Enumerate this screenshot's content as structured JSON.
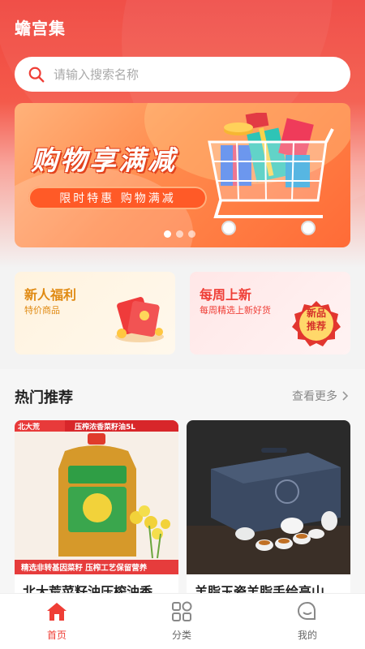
{
  "app": {
    "title": "蟾宫集"
  },
  "search": {
    "placeholder": "请输入搜索名称"
  },
  "banner": {
    "title": "购物享满减",
    "subtitle": "限时特惠  购物满减",
    "slide_count": 3,
    "active_slide": 1
  },
  "promos": [
    {
      "title": "新人福利",
      "subtitle": "特价商品",
      "color": "#e08a12"
    },
    {
      "title": "每周上新",
      "subtitle": "每周精选上新好货",
      "badge": [
        "新品",
        "推荐"
      ],
      "color": "#ef3e36"
    }
  ],
  "hot": {
    "title": "热门推荐",
    "more_label": "查看更多",
    "products": [
      {
        "name": "北大荒菜籽油压榨油香",
        "img_top_label": "压榨浓香菜籽油5L",
        "img_brand": "北大荒",
        "img_bottom_label": "精选非转基因菜籽 压榨工艺保留营养"
      },
      {
        "name": "羊脂玉瓷羊脂手绘高山"
      }
    ]
  },
  "tabbar": {
    "items": [
      {
        "label": "首页",
        "icon": "home-icon",
        "active": true
      },
      {
        "label": "分类",
        "icon": "category-icon",
        "active": false
      },
      {
        "label": "我的",
        "icon": "chat-icon",
        "active": false
      }
    ]
  },
  "colors": {
    "accent": "#ef3e36",
    "header": "#f0463f"
  }
}
